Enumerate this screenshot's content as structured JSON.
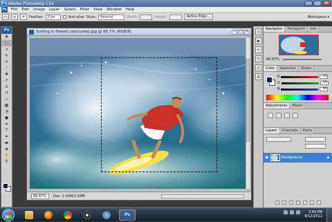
{
  "app": {
    "title": "Adobe Photoshop CS4",
    "ps_badge": "Ps"
  },
  "window_buttons": {
    "minimize": "–",
    "maximize": "□",
    "close": "✕"
  },
  "menu": [
    "File",
    "Edit",
    "Image",
    "Layer",
    "Select",
    "Filter",
    "View",
    "Window",
    "Help"
  ],
  "options_bar": {
    "feather_label": "Feather:",
    "feather_value": "0 px",
    "antialias_label": "Anti-alias",
    "style_label": "Style:",
    "style_value": "Normal",
    "width_label": "Width:",
    "height_label": "Height:",
    "refine_button": "Refine Edge...",
    "workspace_label": "Workspace ▾"
  },
  "document": {
    "title": "Surfing in Hawaii (obscured).jpg @ 66.7% (RGB/8)",
    "zoom": "66.67%",
    "doc_info": "Doc: 2.93M/2.93M"
  },
  "panels": {
    "nav_tabs": [
      "Navigator",
      "Histogram",
      "Info"
    ],
    "nav_zoom": "66.67%",
    "color_tabs": [
      "Color",
      "Swatches",
      "Styles"
    ],
    "color_rows": [
      {
        "label": "R",
        "value": "14",
        "color": "#d02020"
      },
      {
        "label": "G",
        "value": "26",
        "color": "#20a040"
      },
      {
        "label": "B",
        "value": "90",
        "color": "#2040c0"
      }
    ],
    "adj_tabs": [
      "Adjustments",
      "Masks"
    ],
    "layer_tabs": [
      "Layers",
      "Channels",
      "Paths"
    ],
    "layer_name": "Background"
  },
  "taskbar": {
    "clock_time": "3:44 PM",
    "clock_date": "8/12/2012"
  },
  "colors": {
    "foreground": "#0e1a5a",
    "layer_selected": "#3d7fd6",
    "title_bar": "#5b7ca8"
  }
}
